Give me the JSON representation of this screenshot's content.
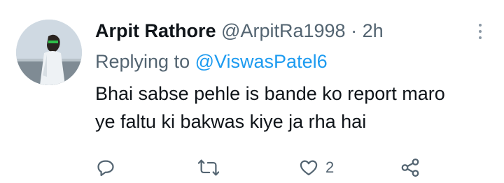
{
  "tweet": {
    "author_name": "Arpit Rathore",
    "author_handle": "@ArpitRa1998",
    "separator": "·",
    "time": "2h",
    "replying_prefix": "Replying to",
    "replying_to": "@ViswasPatel6",
    "text_lines": [
      "Bhai sabse pehle is bande ko report maro",
      "ye faltu ki bakwas kiye ja rha hai"
    ],
    "likes": "2"
  },
  "icons": {
    "reply": "reply-icon",
    "retweet": "retweet-icon",
    "like": "heart-icon",
    "share": "share-icon",
    "more": "more-vertical-icon"
  },
  "colors": {
    "text": "#0f1419",
    "secondary": "#536471",
    "link": "#1d9bf0",
    "icon": "#536471"
  }
}
